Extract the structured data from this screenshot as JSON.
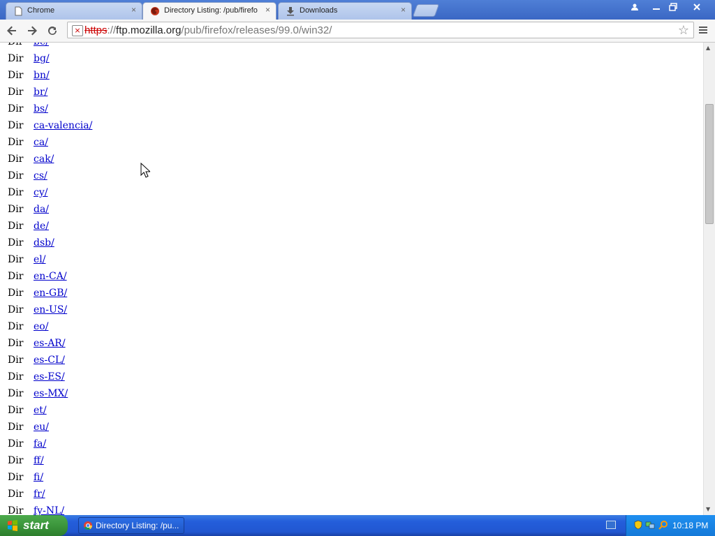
{
  "browser": {
    "tabs": [
      {
        "title": "Chrome",
        "icon": "page-icon",
        "active": false
      },
      {
        "title": "Directory Listing: /pub/firefo",
        "icon": "firefox-icon",
        "active": true
      },
      {
        "title": "Downloads",
        "icon": "download-icon",
        "active": false
      }
    ],
    "close_glyph": "×",
    "url": {
      "scheme": "https",
      "sep": "://",
      "host": "ftp.mozilla.org",
      "path": "/pub/firefox/releases/99.0/win32/"
    }
  },
  "listing": {
    "rows": [
      {
        "type": "Dir",
        "name": "be/"
      },
      {
        "type": "Dir",
        "name": "bg/"
      },
      {
        "type": "Dir",
        "name": "bn/"
      },
      {
        "type": "Dir",
        "name": "br/"
      },
      {
        "type": "Dir",
        "name": "bs/"
      },
      {
        "type": "Dir",
        "name": "ca-valencia/"
      },
      {
        "type": "Dir",
        "name": "ca/"
      },
      {
        "type": "Dir",
        "name": "cak/"
      },
      {
        "type": "Dir",
        "name": "cs/"
      },
      {
        "type": "Dir",
        "name": "cy/"
      },
      {
        "type": "Dir",
        "name": "da/"
      },
      {
        "type": "Dir",
        "name": "de/"
      },
      {
        "type": "Dir",
        "name": "dsb/"
      },
      {
        "type": "Dir",
        "name": "el/"
      },
      {
        "type": "Dir",
        "name": "en-CA/"
      },
      {
        "type": "Dir",
        "name": "en-GB/"
      },
      {
        "type": "Dir",
        "name": "en-US/"
      },
      {
        "type": "Dir",
        "name": "eo/"
      },
      {
        "type": "Dir",
        "name": "es-AR/"
      },
      {
        "type": "Dir",
        "name": "es-CL/"
      },
      {
        "type": "Dir",
        "name": "es-ES/"
      },
      {
        "type": "Dir",
        "name": "es-MX/"
      },
      {
        "type": "Dir",
        "name": "et/"
      },
      {
        "type": "Dir",
        "name": "eu/"
      },
      {
        "type": "Dir",
        "name": "fa/"
      },
      {
        "type": "Dir",
        "name": "ff/"
      },
      {
        "type": "Dir",
        "name": "fi/"
      },
      {
        "type": "Dir",
        "name": "fr/"
      },
      {
        "type": "Dir",
        "name": "fy-NL/"
      }
    ]
  },
  "taskbar": {
    "start_label": "start",
    "task_title": "Directory Listing: /pu...",
    "clock": "10:18 PM"
  },
  "colors": {
    "link": "#0000cc",
    "taskbar": "#245edb",
    "start": "#3c963c"
  }
}
